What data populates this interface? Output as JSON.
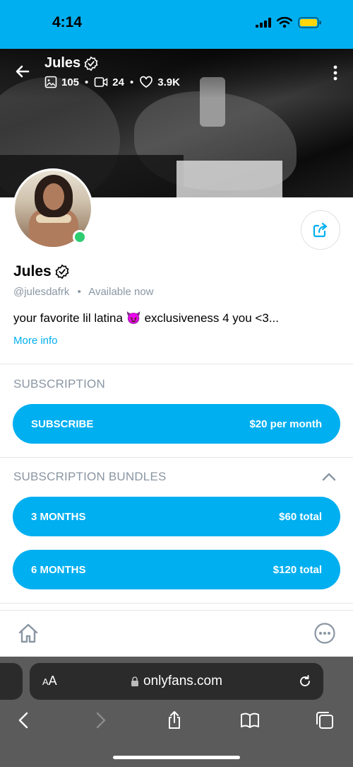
{
  "status_bar": {
    "time": "4:14",
    "icons": [
      "cellular-signal-icon",
      "wifi-icon",
      "battery-icon"
    ],
    "battery_color": "#ffd60a"
  },
  "header": {
    "name": "Jules",
    "stats": {
      "photos": "105",
      "videos": "24",
      "likes": "3.9K"
    },
    "icons": [
      "back-arrow-icon",
      "verified-badge-icon",
      "image-icon",
      "video-icon",
      "heart-icon",
      "more-vertical-icon"
    ]
  },
  "profile": {
    "name": "Jules",
    "handle": "@julesdafrk",
    "separator": "•",
    "availability": "Available now",
    "bio": "your favorite lil latina 😈 exclusiveness 4 you <3...",
    "more_info": "More info",
    "online_color": "#2ecc71",
    "icons": [
      "share-icon",
      "verified-badge-icon"
    ]
  },
  "subscription": {
    "title": "SUBSCRIPTION",
    "button_label": "SUBSCRIBE",
    "button_price": "$20 per month"
  },
  "bundles": {
    "title": "SUBSCRIPTION BUNDLES",
    "items": [
      {
        "label": "3 MONTHS",
        "price": "$60 total"
      },
      {
        "label": "6 MONTHS",
        "price": "$120 total"
      }
    ]
  },
  "bottom_nav": {
    "icons": [
      "home-icon",
      "more-options-icon"
    ]
  },
  "browser": {
    "aa_small": "A",
    "aa_large": "A",
    "url": "onlyfans.com",
    "icons": [
      "lock-icon",
      "reload-icon",
      "back-icon",
      "forward-icon",
      "share-icon",
      "bookmarks-icon",
      "tabs-icon"
    ]
  },
  "colors": {
    "accent": "#00aff0",
    "muted": "#8a96a3"
  }
}
